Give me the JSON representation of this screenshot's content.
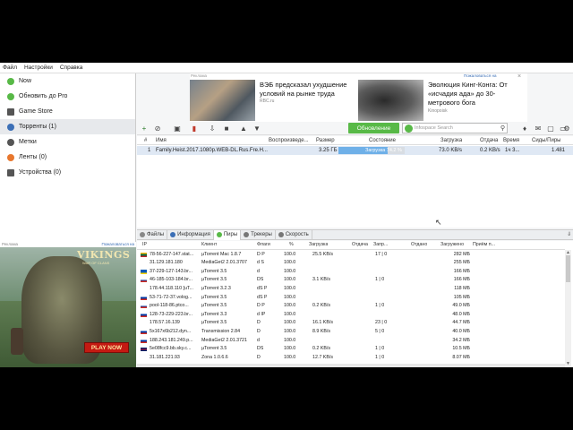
{
  "menu": [
    "Файл",
    "Настройки",
    "Справка"
  ],
  "sidebar": [
    {
      "label": "Now",
      "icon": "now-icon",
      "color": "#58b947"
    },
    {
      "label": "Обновить до Pro",
      "icon": "pro-icon",
      "color": "#58b947"
    },
    {
      "label": "Game Store",
      "icon": "gamestore-icon",
      "color": "#555555"
    },
    {
      "label": "Торренты (1)",
      "icon": "torrents-icon",
      "color": "#3b6fb6"
    },
    {
      "label": "Метки",
      "icon": "labels-icon",
      "color": "#555555"
    },
    {
      "label": "Ленты (0)",
      "icon": "feeds-icon",
      "color": "#e8772e"
    },
    {
      "label": "Устройства (0)",
      "icon": "devices-icon",
      "color": "#555555"
    }
  ],
  "left_ad": {
    "tag": "Реклама",
    "tag_link": "Пожаловаться на",
    "title": "VIKINGS",
    "subtitle": "WAR OF CLANS",
    "button": "PLAY NOW"
  },
  "top_ad": {
    "tag": "Реклама",
    "tag_link": "Пожаловаться на",
    "item1_title": "ВЭБ предсказал ухудшение условий на рынке труда",
    "item1_source": "RBC.ru",
    "item2_title": "Эволюция Кинг-Конга: От «исчадия ада» до 30-метрового бога",
    "item2_source": "Kinopoisk",
    "close": "×"
  },
  "toolbar": {
    "buttons": [
      "+",
      "⊘",
      "▣",
      "▮",
      "⇩",
      "■",
      "▲",
      "▼"
    ],
    "update_label": "Обновление",
    "search_placeholder": "Infospace Search",
    "right_icons": [
      "♦",
      "✉",
      "▢",
      "▭",
      "⚙"
    ]
  },
  "torrents": {
    "columns": [
      "#",
      "Имя",
      "Воспроизведе...",
      "Размер",
      "Состояние",
      "Загрузка",
      "Отдача",
      "Время",
      "Сиды/Пиры"
    ],
    "rows": [
      {
        "num": "1",
        "name": "Family.Heist.2017.1080p.WEB-DL.Rus.Fre.H...",
        "size": "3.25 ГБ",
        "state": "Загрузка 74.2 %",
        "progress": 74.2,
        "down": "73.0 KB/s",
        "up": "0.2 KB/s",
        "eta": "1ч 3...",
        "seeds": "1.481"
      }
    ]
  },
  "tabs": [
    "Файлы",
    "Информация",
    "Пиры",
    "Трекеры",
    "Скорость"
  ],
  "collapse": "⇓",
  "peers": {
    "columns": [
      "IP",
      "Клиент",
      "Флаги",
      "%",
      "Загрузка",
      "Отдача",
      "Запр...",
      "Отдано",
      "Загружено",
      "Приём п..."
    ],
    "rows": [
      {
        "ip": "78-56-227-147.stat...",
        "client": "µTorrent Mac 1.8.7",
        "flags": "D P",
        "pct": "100.0",
        "down": "25.5 KB/s",
        "up": "",
        "req": "17 | 0",
        "sent": "",
        "recv": "282 МБ",
        "flag": "lt"
      },
      {
        "ip": "31.129.181.180",
        "client": "MediaGet2 2.01.3707",
        "flags": "d S",
        "pct": "100.0",
        "down": "",
        "up": "",
        "req": "",
        "sent": "",
        "recv": "255 МБ",
        "flag": ""
      },
      {
        "ip": "37-229-127-143.br...",
        "client": "µTorrent 3.5",
        "flags": "d",
        "pct": "100.0",
        "down": "",
        "up": "",
        "req": "",
        "sent": "",
        "recv": "166 МБ",
        "flag": "ua"
      },
      {
        "ip": "46-185-103-184.br...",
        "client": "µTorrent 3.5",
        "flags": "DS",
        "pct": "100.0",
        "down": "3.1 KB/s",
        "up": "",
        "req": "1 | 0",
        "sent": "",
        "recv": "166 МБ",
        "flag": "ru"
      },
      {
        "ip": "178.44.118.110 [uT...",
        "client": "µTorrent 3.2.3",
        "flags": "dS P",
        "pct": "100.0",
        "down": "",
        "up": "",
        "req": "",
        "sent": "",
        "recv": "118 МБ",
        "flag": ""
      },
      {
        "ip": "53-71-72-37.volog...",
        "client": "µTorrent 3.5",
        "flags": "dS P",
        "pct": "100.0",
        "down": "",
        "up": "",
        "req": "",
        "sent": "",
        "recv": "105 МБ",
        "flag": "ru"
      },
      {
        "ip": "pool-118-86.ptco...",
        "client": "µTorrent 3.5",
        "flags": "D P",
        "pct": "100.0",
        "down": "0.2 KB/s",
        "up": "",
        "req": "1 | 0",
        "sent": "",
        "recv": "49.0 МБ",
        "flag": "ru"
      },
      {
        "ip": "128-73-229-223.br...",
        "client": "µTorrent 3.3",
        "flags": "d IP",
        "pct": "100.0",
        "down": "",
        "up": "",
        "req": "",
        "sent": "",
        "recv": "48.0 МБ",
        "flag": "ru"
      },
      {
        "ip": "178.57.16.139",
        "client": "µTorrent 3.5",
        "flags": "D",
        "pct": "100.0",
        "down": "16.1 KB/s",
        "up": "",
        "req": "23 | 0",
        "sent": "",
        "recv": "44.7 МБ",
        "flag": ""
      },
      {
        "ip": "5x167x6b212.dyn...",
        "client": "Transmission 2.84",
        "flags": "D",
        "pct": "100.0",
        "down": "8.9 KB/s",
        "up": "",
        "req": "5 | 0",
        "sent": "",
        "recv": "40.0 МБ",
        "flag": "ru"
      },
      {
        "ip": "188.243.181.249.p...",
        "client": "MediaGet2 2.01.3721",
        "flags": "d",
        "pct": "100.0",
        "down": "",
        "up": "",
        "req": "",
        "sent": "",
        "recv": "34.2 МБ",
        "flag": "ru"
      },
      {
        "ip": "5e08fcc9.bb.sky.c...",
        "client": "µTorrent 3.5",
        "flags": "DS",
        "pct": "100.0",
        "down": "0.2 KB/s",
        "up": "",
        "req": "1 | 0",
        "sent": "",
        "recv": "10.5 МБ",
        "flag": "gb"
      },
      {
        "ip": "31.181.221.93",
        "client": "Zona 1.0.6.6",
        "flags": "D",
        "pct": "100.0",
        "down": "12.7 KB/s",
        "up": "",
        "req": "1 | 0",
        "sent": "",
        "recv": "8.07 МБ",
        "flag": ""
      }
    ]
  }
}
